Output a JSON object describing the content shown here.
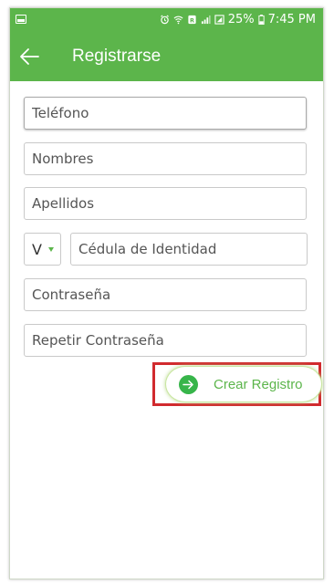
{
  "status_bar": {
    "battery": "25%",
    "time": "7:45 PM"
  },
  "app_bar": {
    "title": "Registrarse",
    "back_icon": "arrow-left-icon"
  },
  "form": {
    "telefono_placeholder": "Teléfono",
    "nombres_placeholder": "Nombres",
    "apellidos_placeholder": "Apellidos",
    "id_type_value": "V",
    "cedula_placeholder": "Cédula de Identidad",
    "contrasena_placeholder": "Contraseña",
    "repetir_contrasena_placeholder": "Repetir Contraseña"
  },
  "actions": {
    "create_label": "Crear Registro",
    "create_icon": "arrow-right-circle-icon"
  },
  "colors": {
    "primary": "#5cb54b",
    "icon_green": "#37b54a",
    "highlight": "#d12a2e"
  }
}
